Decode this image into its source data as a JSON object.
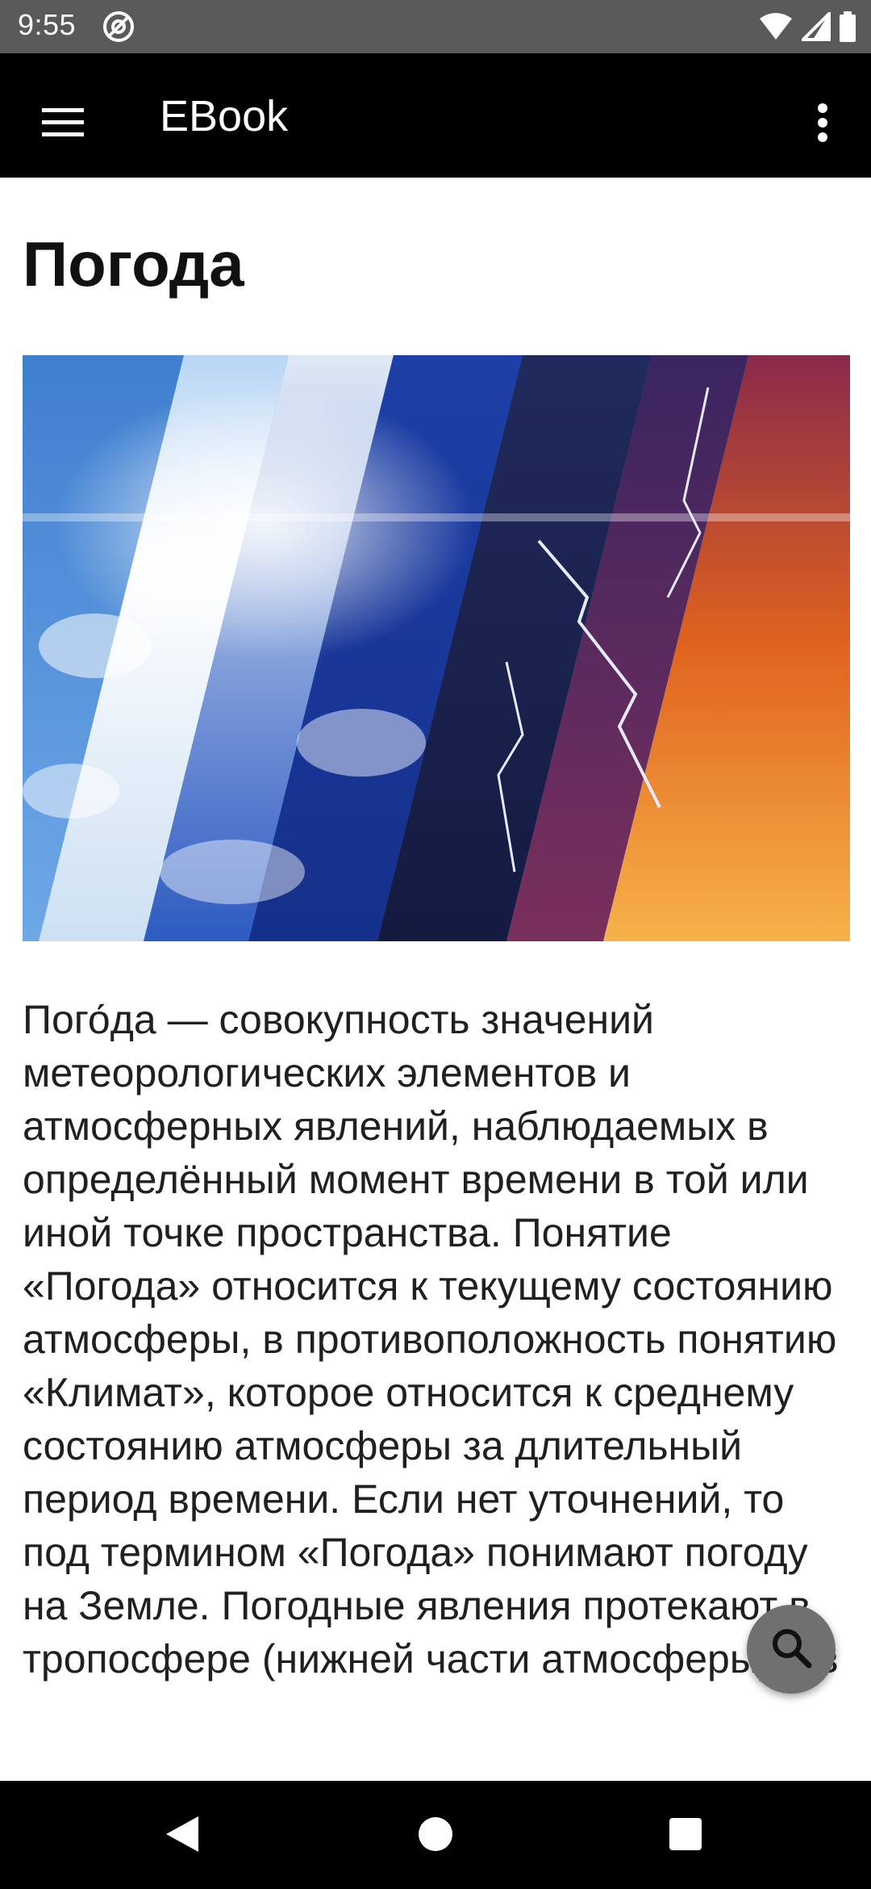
{
  "status_bar": {
    "time": "9:55"
  },
  "app_bar": {
    "title": "EBook"
  },
  "article": {
    "title": "Погода",
    "image": {
      "icon": "weather-collage-image",
      "colors": [
        "#4a8fd8",
        "#cfe3f7",
        "#1f49b8",
        "#1a1f55",
        "#6a2a6f",
        "#e26a1c"
      ]
    },
    "body": "Пого́да — совокупность значений метеорологических элементов и атмосферных явлений, наблюдаемых в определённый момент времени в той или иной точке пространства. Понятие «Погода» относится к текущему состоянию атмосферы, в противоположность понятию «Климат», которое относится к среднему состоянию атмосферы за длительный период времени. Если нет уточнений, то под термином «Погода» понимают погоду на Земле. Погодные явления протекают в тропосфере (нижней части атмосферы) и в"
  },
  "fab": {
    "icon": "search-icon"
  },
  "colors": {
    "status_bar": "#5a5a5a",
    "app_bar": "#000000",
    "fab": "#707070",
    "nav_bar": "#000000"
  }
}
